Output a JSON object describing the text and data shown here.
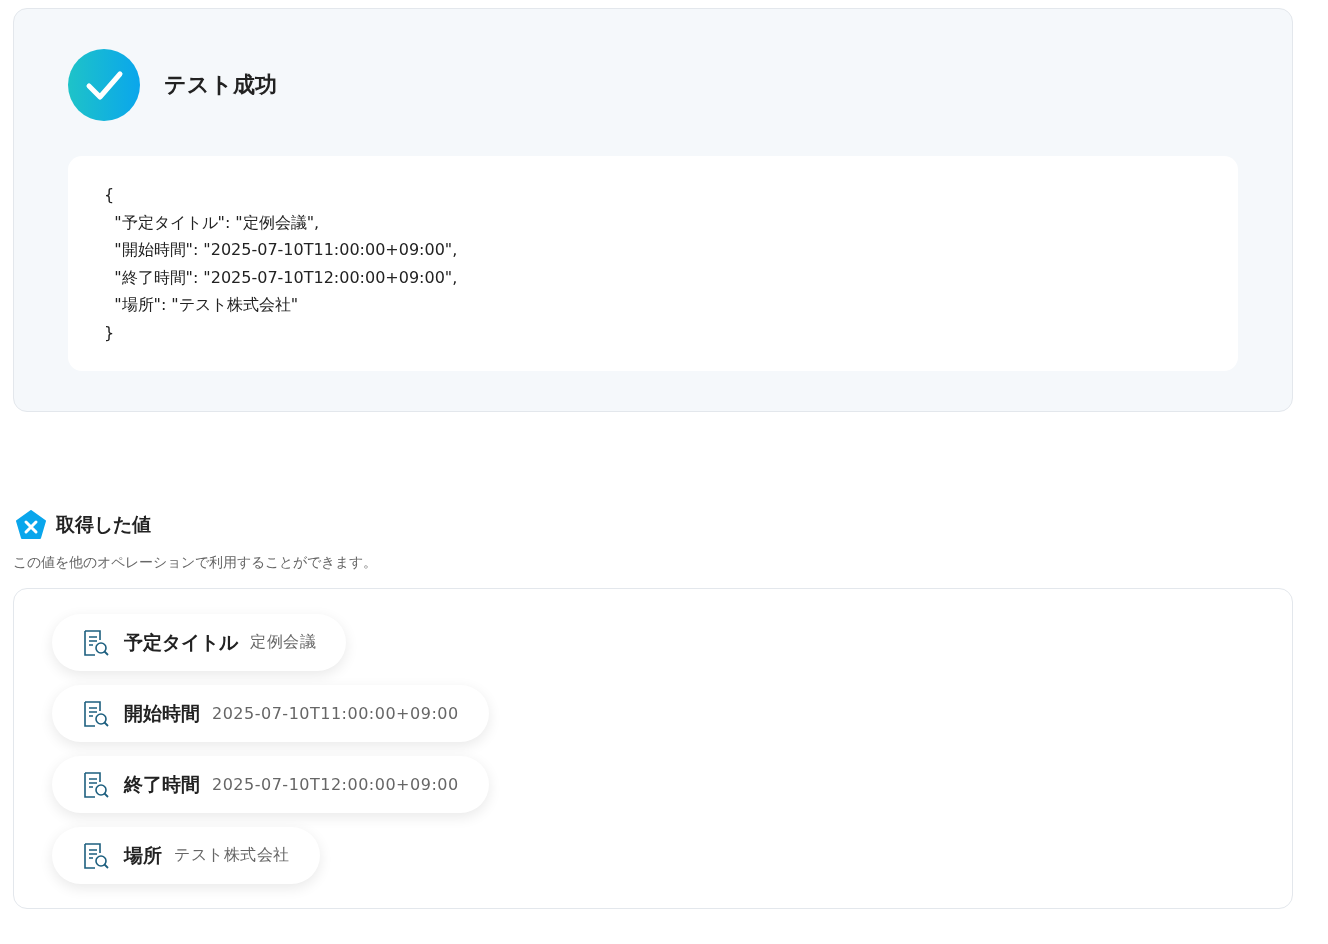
{
  "result": {
    "title": "テスト成功",
    "code_lines": [
      "{",
      "  \"予定タイトル\": \"定例会議\",",
      "  \"開始時間\": \"2025-07-10T11:00:00+09:00\",",
      "  \"終了時間\": \"2025-07-10T12:00:00+09:00\",",
      "  \"場所\": \"テスト株式会社\"",
      "}"
    ]
  },
  "values": {
    "title": "取得した値",
    "description": "この値を他のオペレーションで利用することができます。",
    "items": [
      {
        "label": "予定タイトル",
        "value": "定例会議"
      },
      {
        "label": "開始時間",
        "value": "2025-07-10T11:00:00+09:00"
      },
      {
        "label": "終了時間",
        "value": "2025-07-10T12:00:00+09:00"
      },
      {
        "label": "場所",
        "value": "テスト株式会社"
      }
    ]
  }
}
